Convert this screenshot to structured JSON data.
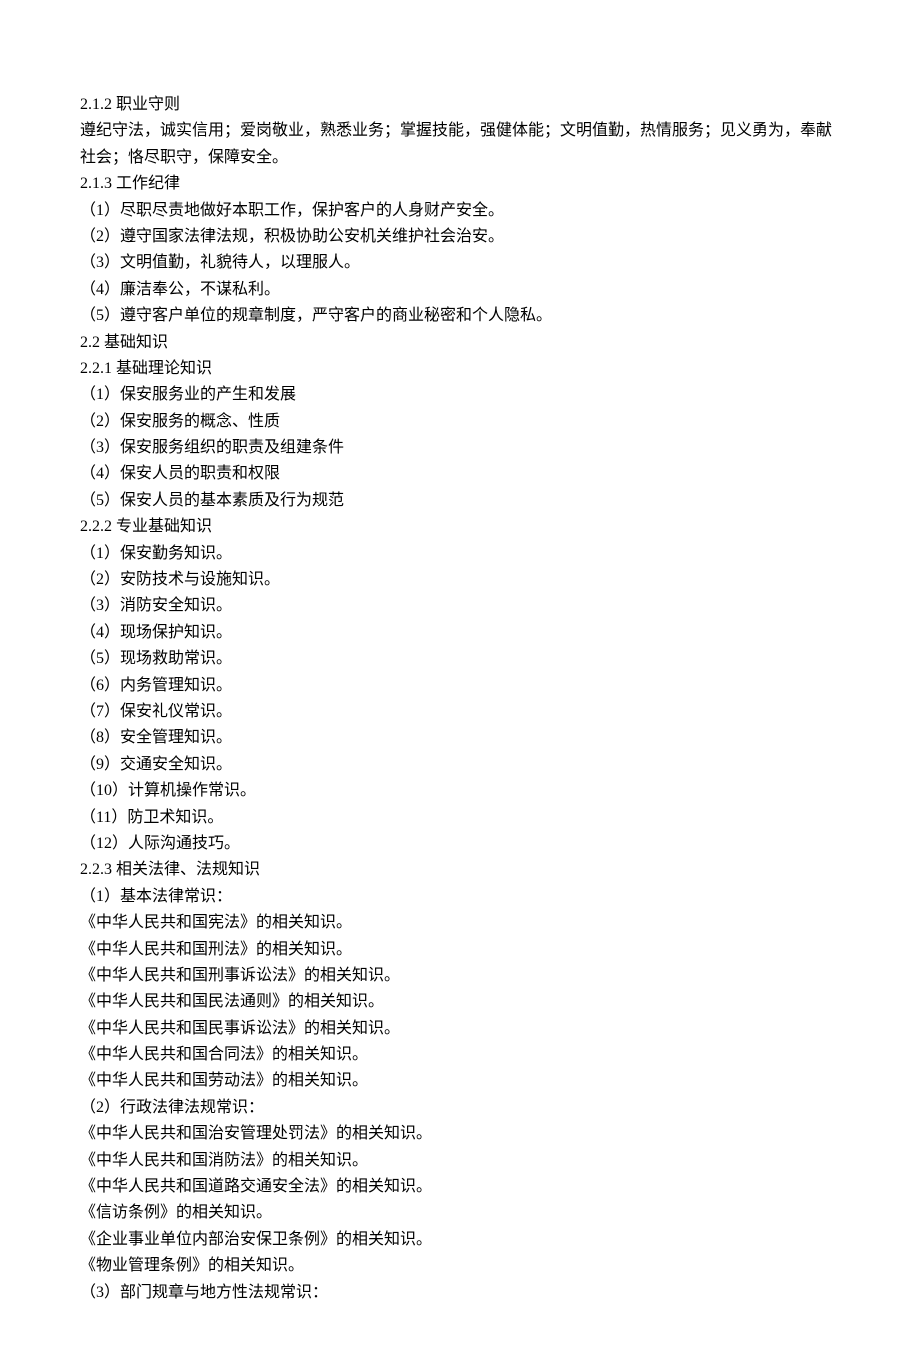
{
  "lines": [
    "2.1.2 职业守则",
    "遵纪守法，诚实信用；爱岗敬业，熟悉业务；掌握技能，强健体能；文明值勤，热情服务；见义勇为，奉献社会；恪尽职守，保障安全。",
    "2.1.3 工作纪律",
    "（1）尽职尽责地做好本职工作，保护客户的人身财产安全。",
    "（2）遵守国家法律法规，积极协助公安机关维护社会治安。",
    "（3）文明值勤，礼貌待人，以理服人。",
    "（4）廉洁奉公，不谋私利。",
    "（5）遵守客户单位的规章制度，严守客户的商业秘密和个人隐私。",
    "2.2 基础知识",
    "2.2.1 基础理论知识",
    "（1）保安服务业的产生和发展",
    "（2）保安服务的概念、性质",
    "（3）保安服务组织的职责及组建条件",
    "（4）保安人员的职责和权限",
    "（5）保安人员的基本素质及行为规范",
    "2.2.2 专业基础知识",
    "（1）保安勤务知识。",
    "（2）安防技术与设施知识。",
    "（3）消防安全知识。",
    "（4）现场保护知识。",
    "（5）现场救助常识。",
    "（6）内务管理知识。",
    "（7）保安礼仪常识。",
    "（8）安全管理知识。",
    "（9）交通安全知识。",
    "（10）计算机操作常识。",
    "（11）防卫术知识。",
    "（12）人际沟通技巧。",
    "2.2.3 相关法律、法规知识",
    "（1）基本法律常识：",
    "《中华人民共和国宪法》的相关知识。",
    "《中华人民共和国刑法》的相关知识。",
    "《中华人民共和国刑事诉讼法》的相关知识。",
    "《中华人民共和国民法通则》的相关知识。",
    "《中华人民共和国民事诉讼法》的相关知识。",
    "《中华人民共和国合同法》的相关知识。",
    "《中华人民共和国劳动法》的相关知识。",
    "（2）行政法律法规常识：",
    "《中华人民共和国治安管理处罚法》的相关知识。",
    "《中华人民共和国消防法》的相关知识。",
    "《中华人民共和国道路交通安全法》的相关知识。",
    "《信访条例》的相关知识。",
    "《企业事业单位内部治安保卫条例》的相关知识。",
    "《物业管理条例》的相关知识。",
    "（3）部门规章与地方性法规常识："
  ]
}
